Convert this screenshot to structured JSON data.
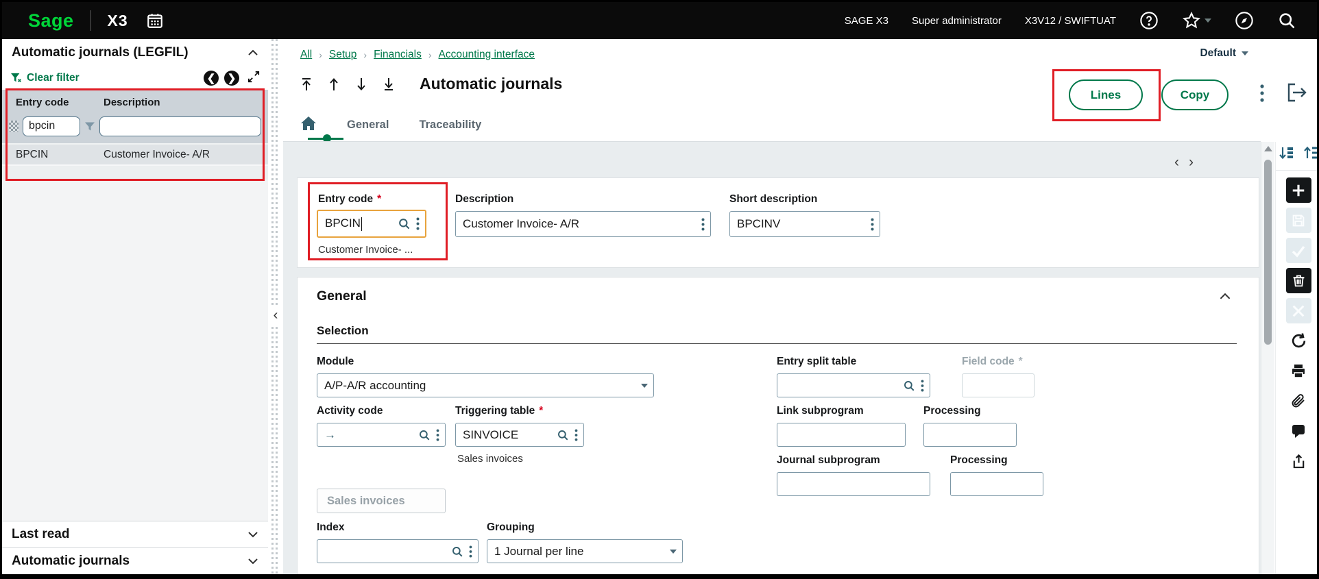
{
  "topbar": {
    "brand": "Sage",
    "product": "X3",
    "app_label": "SAGE X3",
    "user": "Super administrator",
    "environment": "X3V12 / SWIFTUAT"
  },
  "left_panel": {
    "title": "Automatic journals (LEGFIL)",
    "clear_filter_label": "Clear filter",
    "table": {
      "col_entry_code": "Entry code",
      "col_description": "Description",
      "filter_entry_code": "bpcin",
      "filter_description": "",
      "rows": [
        {
          "entry_code": "BPCIN",
          "description": "Customer Invoice- A/R"
        }
      ]
    },
    "sections": [
      {
        "label": "Last read"
      },
      {
        "label": "Automatic journals"
      }
    ]
  },
  "breadcrumb": {
    "items": [
      "All",
      "Setup",
      "Financials",
      "Accounting interface"
    ],
    "separator": "›"
  },
  "view_selector": {
    "value": "Default"
  },
  "page": {
    "title": "Automatic journals"
  },
  "actions": {
    "lines": "Lines",
    "copy": "Copy"
  },
  "tabs": {
    "general": "General",
    "traceability": "Traceability"
  },
  "record_nav": {
    "prev": "‹",
    "next": "›"
  },
  "header_fields": {
    "entry_code": {
      "label": "Entry code",
      "required": "*",
      "value": "BPCIN",
      "helper": "Customer Invoice- ..."
    },
    "description": {
      "label": "Description",
      "value": "Customer Invoice- A/R"
    },
    "short_description": {
      "label": "Short description",
      "value": "BPCINV"
    }
  },
  "general": {
    "title": "General",
    "selection_title": "Selection",
    "module": {
      "label": "Module",
      "value": "A/P-A/R accounting"
    },
    "entry_split_table": {
      "label": "Entry split table",
      "value": ""
    },
    "field_code": {
      "label": "Field code",
      "required": "*",
      "value": ""
    },
    "activity_code": {
      "label": "Activity code",
      "value": ""
    },
    "triggering_table": {
      "label": "Triggering table",
      "required": "*",
      "value": "SINVOICE",
      "helper": "Sales invoices"
    },
    "link_subprogram": {
      "label": "Link subprogram",
      "value": ""
    },
    "processing_link": {
      "label": "Processing",
      "value": ""
    },
    "journal_subprogram": {
      "label": "Journal subprogram",
      "value": ""
    },
    "processing_journal": {
      "label": "Processing",
      "value": ""
    },
    "sales_invoices_button": "Sales invoices",
    "index": {
      "label": "Index",
      "value": ""
    },
    "grouping": {
      "label": "Grouping",
      "value": "1 Journal per line"
    }
  },
  "colors": {
    "sage_green": "#00d639",
    "link_green": "#00784a",
    "annotation_red": "#e01d25",
    "focus_orange": "#e8a33d",
    "icon_slate": "#35606f"
  }
}
